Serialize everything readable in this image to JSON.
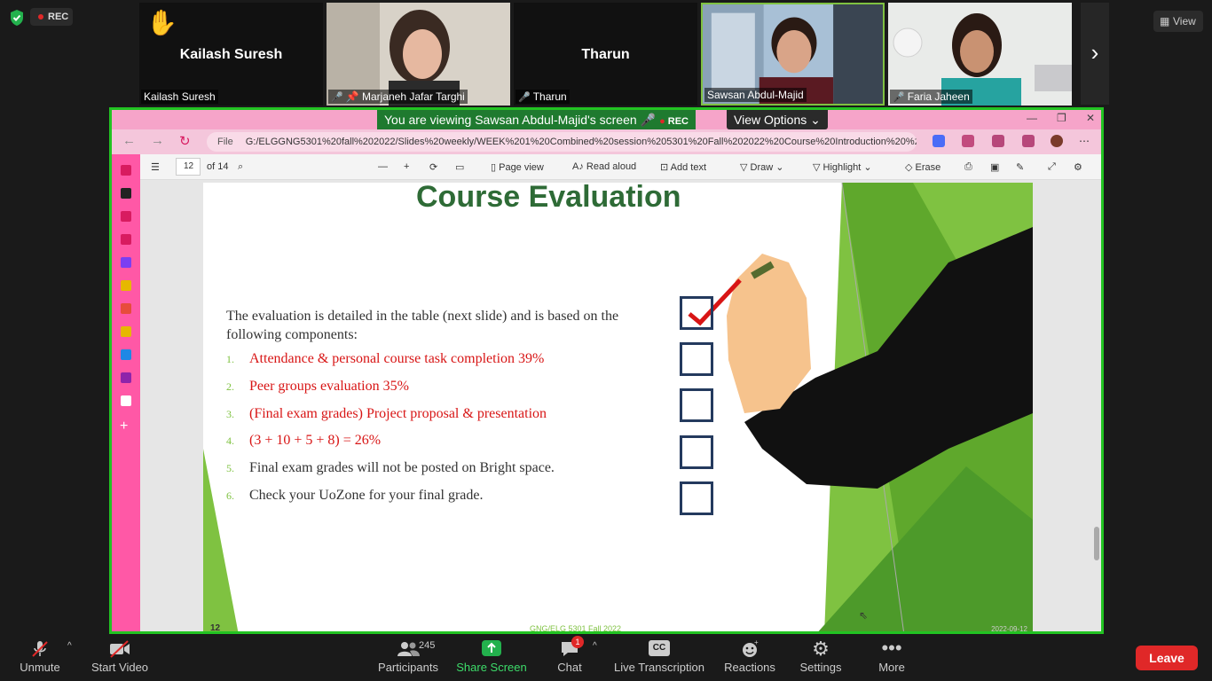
{
  "top": {
    "rec": "REC",
    "view": "View",
    "participants": [
      {
        "big_name": "Kailash Suresh",
        "label": "Kailash Suresh",
        "raised_hand": true
      },
      {
        "big_name": "",
        "label": "Marjaneh Jafar Targhi",
        "muted": true,
        "pinned": true
      },
      {
        "big_name": "Tharun",
        "label": "Tharun",
        "muted": true
      },
      {
        "big_name": "",
        "label": "Sawsan Abdul-Majid",
        "active": true
      },
      {
        "big_name": "",
        "label": "Faria Jaheen",
        "muted": true
      }
    ]
  },
  "share": {
    "viewing_text": "You are viewing Sawsan Abdul-Majid's screen",
    "rec": "REC",
    "view_options": "View Options",
    "url_prefix": "File",
    "url": "G:/ELGGNG5301%20fall%202022/Slides%20weekly/WEEK%201%20Combined%20session%205301%20Fall%202022%20Course%20Introduction%20%20FINA...",
    "pdf": {
      "page": "12",
      "of": "of 14",
      "page_view": "Page view",
      "read_aloud": "Read aloud",
      "add_text": "Add text",
      "draw": "Draw",
      "highlight": "Highlight",
      "erase": "Erase"
    }
  },
  "slide": {
    "title": "Course Evaluation",
    "intro": "The evaluation is detailed in the table (next slide)  and is based on the following components:",
    "items": [
      {
        "num": "1.",
        "text": "Attendance & personal course task completion 39%"
      },
      {
        "num": "2.",
        "text": "Peer groups evaluation 35%"
      },
      {
        "num": "3.",
        "text": "(Final exam grades) Project proposal & presentation"
      },
      {
        "num": "4.",
        "text": "(3 + 10 + 5 + 8) = 26%"
      },
      {
        "num": "5.",
        "text": "Final exam grades will not be posted on Bright space."
      },
      {
        "num": "6.",
        "text": "Check your UoZone for your final grade."
      }
    ],
    "slide_number": "12",
    "footer": "GNG/ELG 5301 Fall 2022",
    "date": "2022-09-12"
  },
  "bottom": {
    "unmute": "Unmute",
    "start_video": "Start Video",
    "participants_label": "Participants",
    "participants_count": "245",
    "share_screen": "Share Screen",
    "chat": "Chat",
    "chat_badge": "1",
    "live_transcription": "Live Transcription",
    "reactions": "Reactions",
    "settings": "Settings",
    "more": "More",
    "leave": "Leave",
    "cc": "CC"
  }
}
